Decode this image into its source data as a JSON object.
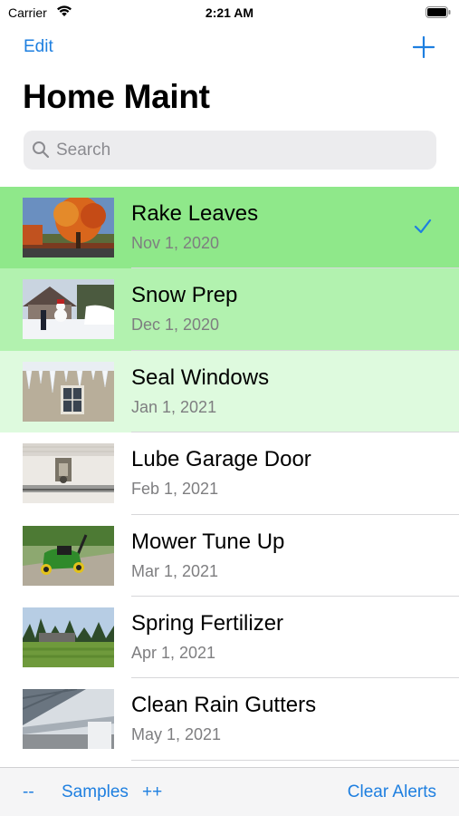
{
  "status_bar": {
    "carrier": "Carrier",
    "time": "2:21 AM"
  },
  "nav": {
    "edit_label": "Edit",
    "add_icon": "plus-icon"
  },
  "title": "Home Maint",
  "search": {
    "placeholder": "Search",
    "value": ""
  },
  "items": [
    {
      "title": "Rake Leaves",
      "date": "Nov 1, 2020",
      "highlight": "#8fe88a",
      "checked": true,
      "thumb": "autumn-tree"
    },
    {
      "title": "Snow Prep",
      "date": "Dec 1, 2020",
      "highlight": "#b2f2af",
      "checked": false,
      "thumb": "snow-scene"
    },
    {
      "title": "Seal Windows",
      "date": "Jan 1, 2021",
      "highlight": "#defade",
      "checked": false,
      "thumb": "icicle-window"
    },
    {
      "title": "Lube Garage Door",
      "date": "Feb 1, 2021",
      "highlight": "#ffffff",
      "checked": false,
      "thumb": "garage-door"
    },
    {
      "title": "Mower Tune Up",
      "date": "Mar 1, 2021",
      "highlight": "#ffffff",
      "checked": false,
      "thumb": "lawn-mower"
    },
    {
      "title": "Spring Fertilizer",
      "date": "Apr 1, 2021",
      "highlight": "#ffffff",
      "checked": false,
      "thumb": "green-lawn"
    },
    {
      "title": "Clean Rain Gutters",
      "date": "May 1, 2021",
      "highlight": "#ffffff",
      "checked": false,
      "thumb": "rain-gutter"
    }
  ],
  "toolbar": {
    "minus_label": "--",
    "samples_label": "Samples",
    "plus_label": "++",
    "clear_label": "Clear Alerts"
  },
  "colors": {
    "accent": "#1e7fe0",
    "secondary_text": "#7e7e80"
  }
}
